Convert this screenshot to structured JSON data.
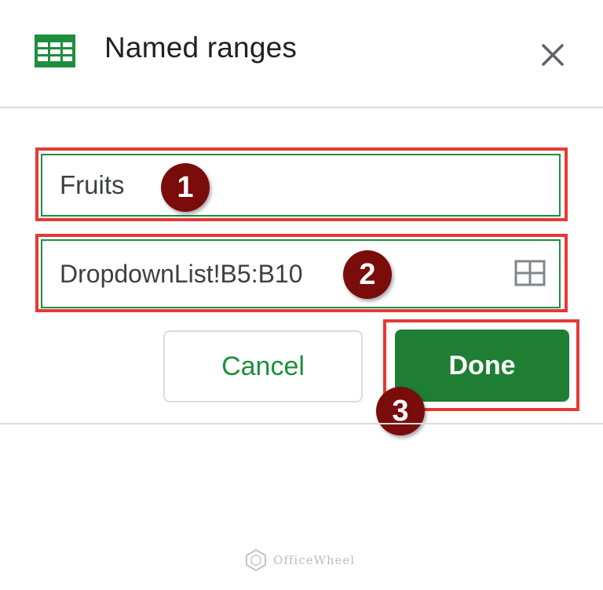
{
  "dialog": {
    "title": "Named ranges",
    "icon": "google-sheets-icon",
    "close_icon": "close-icon"
  },
  "form": {
    "name_value": "Fruits",
    "range_value": "DropdownList!B5:B10",
    "range_icon": "select-data-range-icon"
  },
  "buttons": {
    "cancel_label": "Cancel",
    "done_label": "Done"
  },
  "annotations": {
    "step_1": "1",
    "step_2": "2",
    "step_3": "3"
  },
  "watermark": {
    "text": "OfficeWheel"
  },
  "colors": {
    "accent_green": "#1e8e3e",
    "done_button": "#1e7e34",
    "highlight_red": "#e53935",
    "badge_maroon": "#7a0c0c"
  }
}
